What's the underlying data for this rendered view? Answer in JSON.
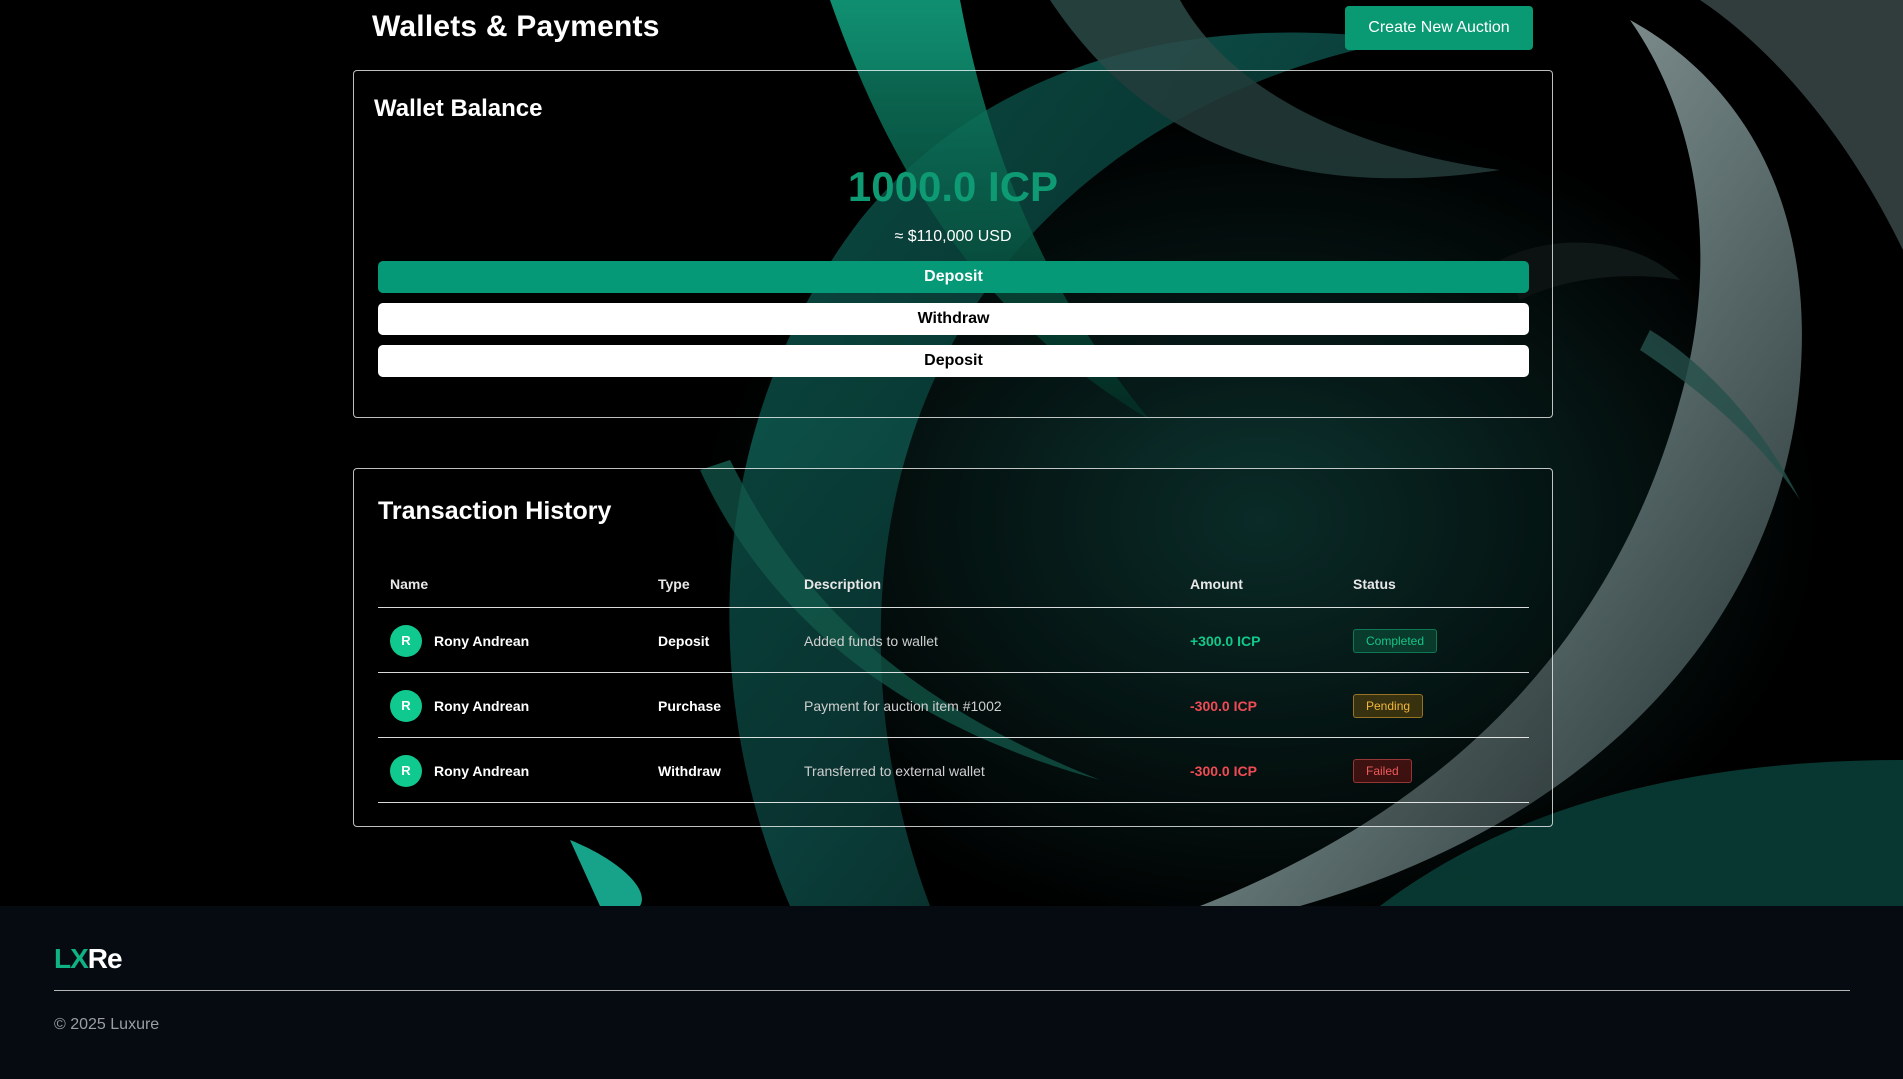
{
  "header": {
    "title": "Wallets & Payments",
    "create_button": "Create New Auction"
  },
  "wallet": {
    "title": "Wallet Balance",
    "balance": "1000.0 ICP",
    "usd_equivalent": "≈ $110,000 USD",
    "buttons": [
      "Deposit",
      "Withdraw",
      "Deposit"
    ]
  },
  "transactions": {
    "title": "Transaction History",
    "columns": [
      "Name",
      "Type",
      "Description",
      "Amount",
      "Status"
    ],
    "rows": [
      {
        "initial": "R",
        "name": "Rony Andrean",
        "type": "Deposit",
        "description": "Added funds to wallet",
        "amount": "+300.0 ICP",
        "status": "Completed"
      },
      {
        "initial": "R",
        "name": "Rony Andrean",
        "type": "Purchase",
        "description": "Payment for auction item #1002",
        "amount": "-300.0 ICP",
        "status": "Pending"
      },
      {
        "initial": "R",
        "name": "Rony Andrean",
        "type": "Withdraw",
        "description": "Transferred to external wallet",
        "amount": "-300.0 ICP",
        "status": "Failed"
      }
    ]
  },
  "footer": {
    "logo_part1": "LX",
    "logo_part2": "Re",
    "copyright": "© 2025 Luxure"
  },
  "colors": {
    "accent": "#0a9a73",
    "positive": "#11c98a",
    "negative": "#f04b54",
    "pending": "#f3b63a"
  }
}
